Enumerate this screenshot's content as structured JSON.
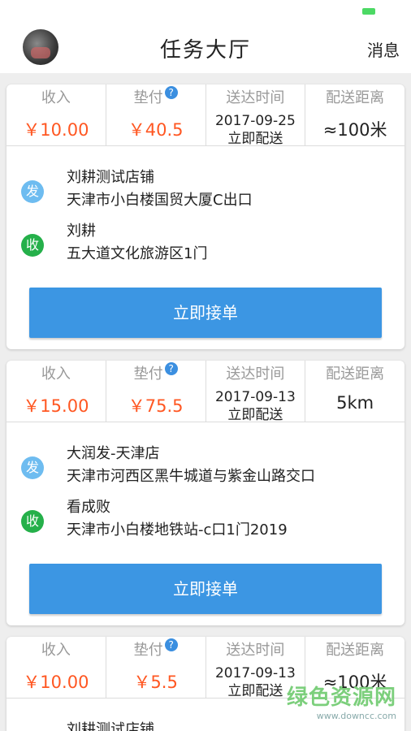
{
  "header": {
    "title": "任务大厅",
    "messages_label": "消息"
  },
  "labels": {
    "income": "收入",
    "advance": "垫付",
    "delivery_time": "送达时间",
    "distance": "配送距离",
    "accept": "立即接单",
    "send_badge": "发",
    "recv_badge": "收",
    "help": "?"
  },
  "orders": [
    {
      "income": "￥10.00",
      "advance": "￥40.5",
      "time": "2017-09-25 立即配送",
      "distance": "≈100米",
      "sender_name": "刘耕测试店铺",
      "sender_address": "天津市小白楼国贸大厦C出口",
      "receiver_name": "刘耕",
      "receiver_address": "五大道文化旅游区1门"
    },
    {
      "income": "￥15.00",
      "advance": "￥75.5",
      "time": "2017-09-13 立即配送",
      "distance": "5km",
      "sender_name": "大润发-天津店",
      "sender_address": "天津市河西区黑牛城道与紫金山路交口",
      "receiver_name": "看成败",
      "receiver_address": "天津市小白楼地铁站-c口1门2019"
    },
    {
      "income": "￥10.00",
      "advance": "￥5.5",
      "time": "2017-09-13 立即配送",
      "distance": "≈100米",
      "sender_name": "刘耕测试店铺"
    }
  ],
  "watermark": {
    "main": "绿色资源网",
    "url": "www.downcc.com"
  },
  "colors": {
    "accent": "#3c96e3",
    "money": "#ff5722",
    "send_badge": "#6ebcf0",
    "recv_badge": "#25b04a"
  }
}
